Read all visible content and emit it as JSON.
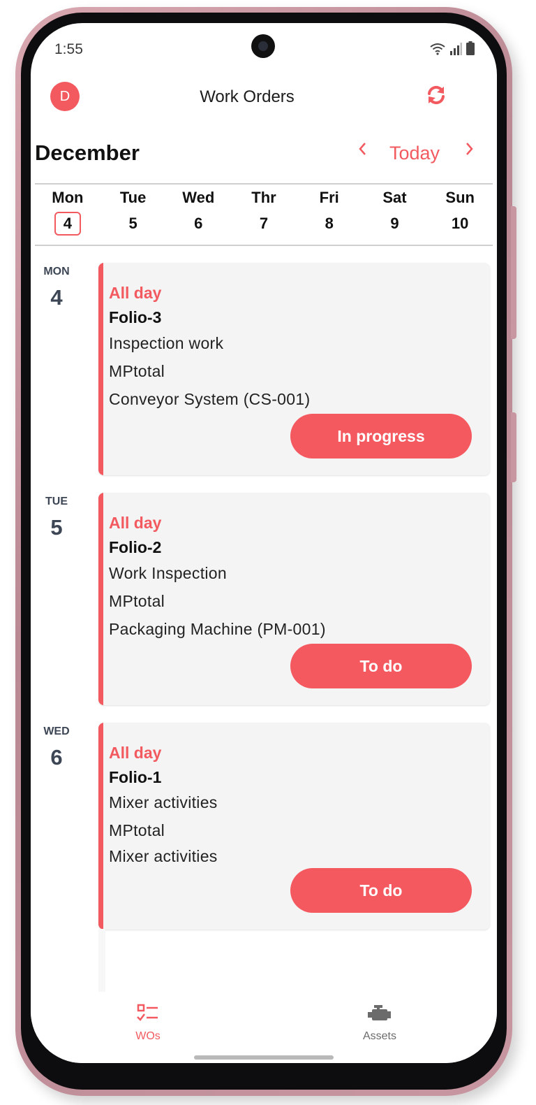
{
  "status_bar": {
    "time": "1:55"
  },
  "header": {
    "avatar_letter": "D",
    "title": "Work Orders"
  },
  "calendar": {
    "month": "December",
    "today_label": "Today",
    "week": [
      {
        "name": "Mon",
        "num": "4",
        "selected": true
      },
      {
        "name": "Tue",
        "num": "5"
      },
      {
        "name": "Wed",
        "num": "6"
      },
      {
        "name": "Thr",
        "num": "7"
      },
      {
        "name": "Fri",
        "num": "8"
      },
      {
        "name": "Sat",
        "num": "9"
      },
      {
        "name": "Sun",
        "num": "10"
      }
    ]
  },
  "agenda": [
    {
      "day_abbr": "MON",
      "day_num": "4",
      "when": "All day",
      "folio": "Folio-3",
      "lines": [
        "Inspection work",
        "MPtotal",
        "Conveyor System (CS-001)"
      ],
      "status": "In progress"
    },
    {
      "day_abbr": "TUE",
      "day_num": "5",
      "when": "All day",
      "folio": "Folio-2",
      "lines": [
        "Work Inspection",
        "MPtotal",
        "Packaging Machine (PM-001)"
      ],
      "status": "To do"
    },
    {
      "day_abbr": "WED",
      "day_num": "6",
      "when": "All day",
      "folio": "Folio-1",
      "lines": [
        "Mixer activities",
        "MPtotal",
        "Mixer activities"
      ],
      "status": "To do"
    }
  ],
  "bottom_nav": {
    "wos_label": "WOs",
    "assets_label": "Assets",
    "active_color": "#f25a60",
    "inactive_color": "#6b6b6b"
  },
  "colors": {
    "accent": "#f25a60"
  }
}
